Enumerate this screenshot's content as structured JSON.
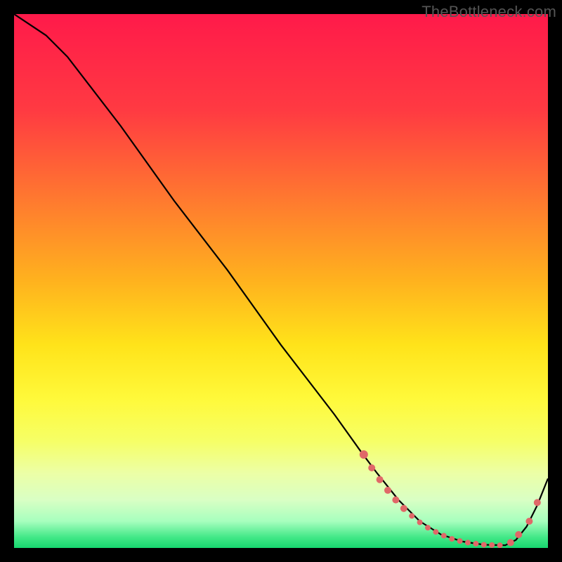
{
  "watermark": "TheBottleneck.com",
  "chart_data": {
    "type": "line",
    "title": "",
    "xlabel": "",
    "ylabel": "",
    "xlim": [
      0,
      100
    ],
    "ylim": [
      0,
      100
    ],
    "grid": false,
    "legend": false,
    "gradient_stops": [
      {
        "offset": 0.0,
        "color": "#ff1a4a"
      },
      {
        "offset": 0.18,
        "color": "#ff3a42"
      },
      {
        "offset": 0.35,
        "color": "#ff7a2f"
      },
      {
        "offset": 0.5,
        "color": "#ffb21e"
      },
      {
        "offset": 0.62,
        "color": "#ffe31a"
      },
      {
        "offset": 0.72,
        "color": "#fff93a"
      },
      {
        "offset": 0.8,
        "color": "#f6ff66"
      },
      {
        "offset": 0.86,
        "color": "#ecffa6"
      },
      {
        "offset": 0.91,
        "color": "#d9ffc4"
      },
      {
        "offset": 0.95,
        "color": "#a7ffbe"
      },
      {
        "offset": 0.98,
        "color": "#42e887"
      },
      {
        "offset": 1.0,
        "color": "#17d66f"
      }
    ],
    "series": [
      {
        "name": "curve",
        "color": "#000000",
        "x": [
          0,
          6,
          10,
          20,
          30,
          40,
          50,
          60,
          65,
          68,
          72,
          76,
          80,
          84,
          88,
          92,
          94,
          96,
          98,
          100
        ],
        "y": [
          100,
          96,
          92,
          79,
          65,
          52,
          38,
          25,
          18,
          14,
          9,
          5,
          2.5,
          1.2,
          0.6,
          0.5,
          1.5,
          4,
          8,
          13
        ]
      }
    ],
    "markers": {
      "name": "highlight-dots",
      "color": "#e06868",
      "radius_small": 4,
      "radius_large": 6,
      "points": [
        {
          "x": 65.5,
          "y": 17.5,
          "r": 6
        },
        {
          "x": 67.0,
          "y": 15.0,
          "r": 5
        },
        {
          "x": 68.5,
          "y": 12.8,
          "r": 5
        },
        {
          "x": 70.0,
          "y": 10.8,
          "r": 5
        },
        {
          "x": 71.5,
          "y": 9.0,
          "r": 5
        },
        {
          "x": 73.0,
          "y": 7.4,
          "r": 5
        },
        {
          "x": 74.5,
          "y": 6.0,
          "r": 4
        },
        {
          "x": 76.0,
          "y": 4.8,
          "r": 4
        },
        {
          "x": 77.5,
          "y": 3.8,
          "r": 4
        },
        {
          "x": 79.0,
          "y": 3.0,
          "r": 4
        },
        {
          "x": 80.5,
          "y": 2.3,
          "r": 4
        },
        {
          "x": 82.0,
          "y": 1.7,
          "r": 4
        },
        {
          "x": 83.5,
          "y": 1.3,
          "r": 4
        },
        {
          "x": 85.0,
          "y": 1.0,
          "r": 4
        },
        {
          "x": 86.5,
          "y": 0.8,
          "r": 4
        },
        {
          "x": 88.0,
          "y": 0.6,
          "r": 4
        },
        {
          "x": 89.5,
          "y": 0.55,
          "r": 4
        },
        {
          "x": 91.0,
          "y": 0.5,
          "r": 4
        },
        {
          "x": 93.0,
          "y": 1.0,
          "r": 5
        },
        {
          "x": 94.5,
          "y": 2.5,
          "r": 5
        },
        {
          "x": 96.5,
          "y": 5.0,
          "r": 5
        },
        {
          "x": 98.0,
          "y": 8.5,
          "r": 5
        }
      ]
    }
  }
}
